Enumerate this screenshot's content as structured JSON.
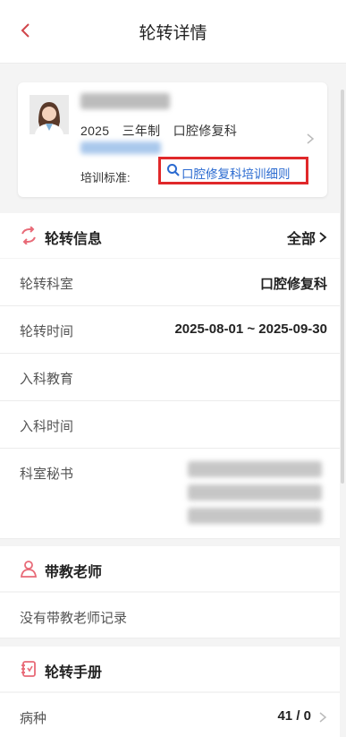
{
  "header": {
    "title": "轮转详情"
  },
  "profile": {
    "year": "2025",
    "duration": "三年制",
    "specialty": "口腔修复科",
    "standard_label": "培训标准:",
    "standard_link": "口腔修复科培训细则"
  },
  "rotation_info": {
    "title": "轮转信息",
    "all_label": "全部",
    "rows": [
      {
        "label": "轮转科室",
        "value": "口腔修复科"
      },
      {
        "label": "轮转时间",
        "value": "2025-08-01 ~ 2025-09-30"
      },
      {
        "label": "入科教育",
        "value": ""
      },
      {
        "label": "入科时间",
        "value": ""
      },
      {
        "label": "科室秘书",
        "value": ""
      }
    ]
  },
  "teacher": {
    "title": "带教老师",
    "empty_text": "没有带教老师记录"
  },
  "handbook": {
    "title": "轮转手册",
    "rows": [
      {
        "label": "病种",
        "value": "41 / 0"
      }
    ]
  },
  "colors": {
    "accent_red": "#e0282a",
    "link_blue": "#2a6ad0",
    "icon_pink": "#e86a77"
  }
}
